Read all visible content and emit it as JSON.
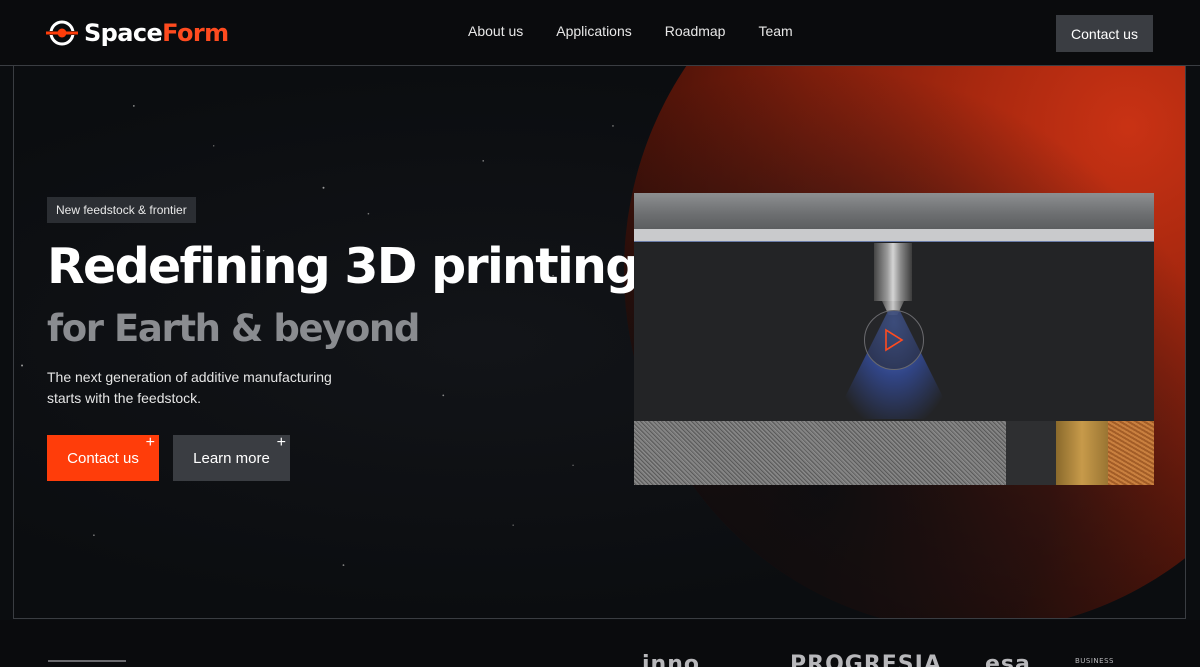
{
  "brand": {
    "name_part1": "Space",
    "name_part2": "Form",
    "accent": "#ff3d0a"
  },
  "nav": {
    "links": [
      "About us",
      "Applications",
      "Roadmap",
      "Team"
    ],
    "cta": "Contact us"
  },
  "hero": {
    "badge": "New feedstock & frontier",
    "title": "Redefining 3D printing",
    "subtitle": "for Earth & beyond",
    "description": "The next generation of additive manufacturing starts with the feedstock.",
    "primary_button": "Contact us",
    "secondary_button": "Learn more",
    "button_plus": "+"
  },
  "video": {
    "play_icon": "play-icon"
  },
  "partners": {
    "logos": [
      "inno",
      "PROGRESJA",
      "esa",
      "BUSINESS"
    ]
  }
}
